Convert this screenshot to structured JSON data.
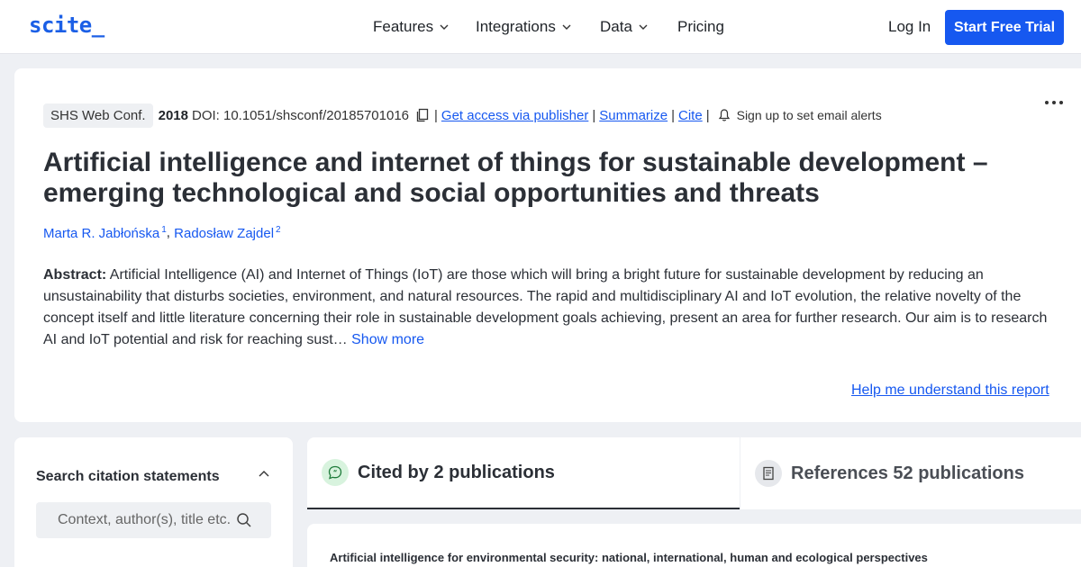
{
  "header": {
    "logo": "scite_",
    "nav": {
      "features": "Features",
      "integrations": "Integrations",
      "data": "Data",
      "pricing": "Pricing"
    },
    "login": "Log In",
    "cta": "Start Free Trial",
    "accent_color": "#1658f0"
  },
  "report": {
    "journal": "SHS Web Conf.",
    "year": "2018",
    "doi": "DOI: 10.1051/shsconf/20185701016",
    "links": {
      "access": "Get access via publisher",
      "summarize": "Summarize",
      "cite": "Cite"
    },
    "separator": "|",
    "alerts": "Sign up to set email alerts",
    "title": "Artificial intelligence and internet of things for sustainable development – emerging technological and social opportunities and threats",
    "authors": [
      {
        "name": "Marta R. Jabłońska",
        "sup": "1"
      },
      {
        "name": "Radosław Zajdel",
        "sup": "2"
      }
    ],
    "author_separator": ", ",
    "abstract_label": "Abstract:",
    "abstract": "Artificial Intelligence (AI) and Internet of Things (IoT) are those which will bring a bright future for sustainable development by reducing an unsustainability that disturbs societies, environment, and natural resources. The rapid and multidisciplinary AI and IoT evolution, the relative novelty of the concept itself and little literature concerning their role in sustainable development goals achieving, present an area for further research. Our aim is to research AI and IoT potential and risk for reaching sust…",
    "show_more": "Show more",
    "help": "Help me understand this report"
  },
  "search": {
    "title": "Search citation statements",
    "placeholder": "Context, author(s), title etc."
  },
  "tabs": {
    "cited": "Cited by 2 publications",
    "references": "References 52 publications"
  },
  "citations": [
    {
      "title": "Artificial intelligence for environmental security: national, international, human and ecological perspectives"
    }
  ],
  "icons": {
    "dropdown": "chevron-down-icon",
    "copy": "copy-icon",
    "bell": "bell-icon",
    "more": "more-icon",
    "collapse": "chevron-up-icon",
    "search": "search-icon",
    "cited": "quote-bubble-icon",
    "references": "document-icon"
  }
}
